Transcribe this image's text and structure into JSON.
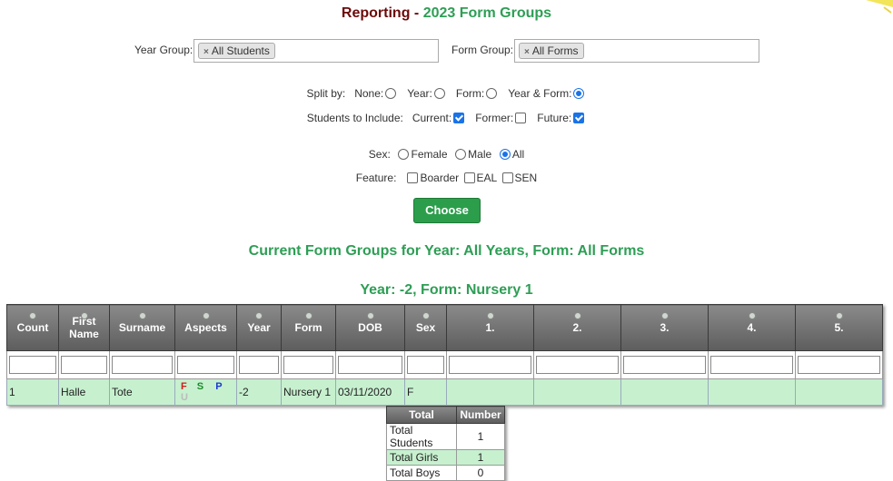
{
  "header": {
    "title_prefix": "Reporting - ",
    "title_main": "2023 Form Groups"
  },
  "filters": {
    "year_group_label": "Year Group:",
    "year_group_tag": "All Students",
    "form_group_label": "Form Group:",
    "form_group_tag": "All Forms",
    "split_by_label": "Split by:",
    "split_options": [
      "None:",
      "Year:",
      "Form:",
      "Year & Form:"
    ],
    "split_selected": "Year & Form:",
    "include_label": "Students to Include:",
    "include_options": [
      {
        "label": "Current:",
        "checked": true
      },
      {
        "label": "Former:",
        "checked": false
      },
      {
        "label": "Future:",
        "checked": true
      }
    ],
    "sex_label": "Sex:",
    "sex_options": [
      "Female",
      "Male",
      "All"
    ],
    "sex_selected": "All",
    "feature_label": "Feature:",
    "feature_options": [
      "Boarder",
      "EAL",
      "SEN"
    ],
    "choose_label": "Choose"
  },
  "current_heading": "Current Form Groups for Year: All Years, Form: All Forms",
  "group_heading": "Year: -2, Form: Nursery 1",
  "table": {
    "headers": [
      "Count",
      "First Name",
      "Surname",
      "Aspects",
      "Year",
      "Form",
      "DOB",
      "Sex",
      "1.",
      "2.",
      "3.",
      "4.",
      "5."
    ],
    "rows": [
      {
        "count": "1",
        "first": "Halle",
        "surname": "Tote",
        "aspects": [
          "F",
          "S",
          "P",
          "U"
        ],
        "year": "-2",
        "form": "Nursery 1",
        "dob": "03/11/2020",
        "sex": "F"
      }
    ]
  },
  "aspect_colors": {
    "F": "#d11a1a",
    "S": "#1b8a2a",
    "P": "#1a3ad1",
    "U": "#bbbbbb"
  },
  "totals": {
    "headers": [
      "Total",
      "Number"
    ],
    "rows": [
      {
        "label": "Total Students",
        "value": "1"
      },
      {
        "label": "Total Girls",
        "value": "1"
      },
      {
        "label": "Total Boys",
        "value": "0"
      }
    ]
  }
}
